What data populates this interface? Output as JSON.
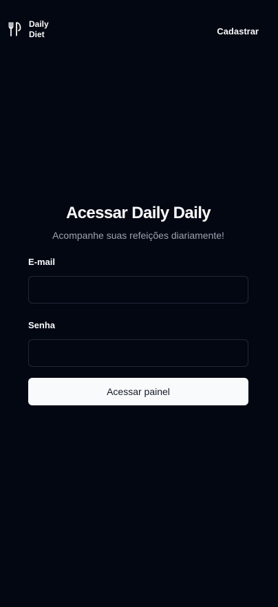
{
  "header": {
    "logo_icon": "fork-knife-icon",
    "brand_line1": "Daily",
    "brand_line2": "Diet",
    "nav_link": "Cadastrar"
  },
  "login": {
    "title": "Acessar Daily Daily",
    "subtitle": "Acompanhe suas refeições diariamente!",
    "email_label": "E-mail",
    "email_value": "",
    "password_label": "Senha",
    "password_value": "",
    "submit_label": "Acessar painel"
  },
  "colors": {
    "background": "#030712",
    "text": "#f9fafb",
    "muted_text": "#9ca3af",
    "input_border": "#1f2937",
    "button_bg": "#f9fafb",
    "button_text": "#111827"
  }
}
